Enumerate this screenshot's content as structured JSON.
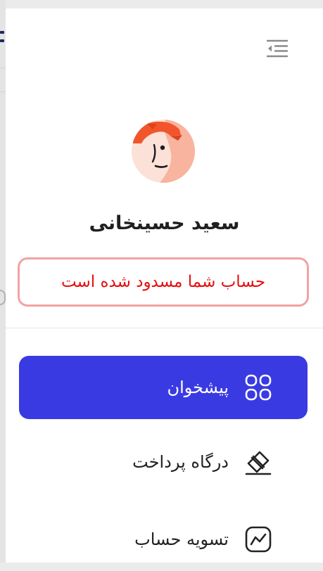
{
  "profile": {
    "name": "سعید حسینخانی",
    "status_message": "حساب شما مسدود شده است",
    "avatar": "avatar-illustration"
  },
  "header": {
    "toggle_icon": "collapse-menu-icon"
  },
  "menu": {
    "items": [
      {
        "label": "پیشخوان",
        "icon": "dashboard-grid-icon",
        "active": true
      },
      {
        "label": "درگاه پرداخت",
        "icon": "payment-card-icon",
        "active": false
      },
      {
        "label": "تسویه حساب",
        "icon": "chart-line-icon",
        "active": false
      }
    ]
  },
  "colors": {
    "accent": "#3a3ae3",
    "alert_text": "#e60f0f",
    "alert_border": "#f1a3a3",
    "avatar_hair": "#f2552c",
    "avatar_skin": "#f9c5b0"
  }
}
